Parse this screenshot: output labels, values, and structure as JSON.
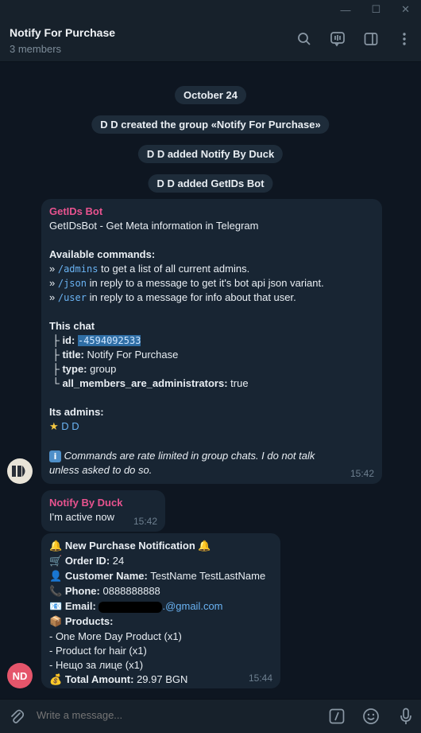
{
  "window": {
    "minimize": "—",
    "maximize": "☐",
    "close": "✕"
  },
  "header": {
    "title": "Notify For Purchase",
    "subtitle": "3 members"
  },
  "system_messages": [
    "October 24",
    "D D created the group «Notify For Purchase»",
    "D D added Notify By Duck",
    "D D added GetIDs Bot"
  ],
  "getids": {
    "sender": "GetIDs Bot",
    "intro": "GetIDsBot - Get Meta information in Telegram",
    "commands_title": "Available commands:",
    "cmd1": "/admins",
    "cmd1_text": " to get a list of all current admins.",
    "cmd2": "/json",
    "cmd2_text": " in reply to a message to get it's bot api json variant.",
    "cmd3": "/user",
    "cmd3_text": " in reply to a message for info about that user.",
    "chat_title": "This chat",
    "id_label": "id:",
    "id_value": "-4594092533",
    "title_label": "title:",
    "title_value": " Notify For Purchase",
    "type_label": "type:",
    "type_value": " group",
    "allmem_label": "all_members_are_administrators:",
    "allmem_value": " true",
    "admins_title": "Its admins:",
    "admin_name": "D D",
    "note": "Commands are rate limited in group chats. I do not talk unless asked to do so.",
    "time": "15:42"
  },
  "duck_active": {
    "sender": "Notify By Duck",
    "text": "I'm active now",
    "time": "15:42"
  },
  "order": {
    "heading": "New Purchase Notification",
    "order_label": "Order ID:",
    "order_value": " 24",
    "customer_label": "Customer Name:",
    "customer_value": " TestName TestLastName",
    "phone_label": "Phone:",
    "phone_value": " 0888888888",
    "email_label": "Email:",
    "email_value": ".@gmail.com",
    "products_label": "Products:",
    "products": [
      " - One More Day Product (x1)",
      " - Product for hair (x1)",
      " - Нещо за лице (x1)"
    ],
    "total_label": "Total Amount:",
    "total_value": " 29.97 BGN",
    "time": "15:44"
  },
  "avatars": {
    "bot": "",
    "user": "ND"
  },
  "compose": {
    "placeholder": "Write a message..."
  },
  "colors": {
    "accent": "#6ab3f3",
    "sender": "#e8538f",
    "avatar_nd": "#e5556b"
  }
}
